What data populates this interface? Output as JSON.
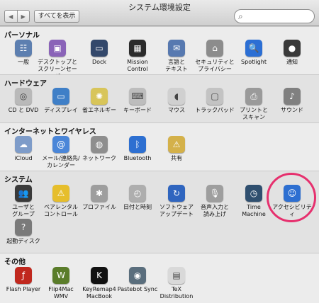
{
  "window": {
    "title": "システム環境設定",
    "show_all": "すべてを表示",
    "back": "◀",
    "forward": "▶",
    "search_placeholder": ""
  },
  "sections": [
    {
      "title": "パーソナル",
      "items": [
        {
          "label": "一般",
          "icon": "general-icon",
          "glyph": "☷",
          "color": "#5d7fb0"
        },
        {
          "label": "デスクトップと\nスクリーンセーバ",
          "icon": "desktop-screensaver-icon",
          "glyph": "▣",
          "color": "#8a63b8"
        },
        {
          "label": "Dock",
          "icon": "dock-icon",
          "glyph": "▭",
          "color": "#33486b"
        },
        {
          "label": "Mission\nControl",
          "icon": "mission-control-icon",
          "glyph": "▦",
          "color": "#2b2b2b"
        },
        {
          "label": "言語と\nテキスト",
          "icon": "language-text-icon",
          "glyph": "✉",
          "color": "#5779b0"
        },
        {
          "label": "セキュリティと\nプライバシー",
          "icon": "security-privacy-icon",
          "glyph": "⌂",
          "color": "#8c8c8c"
        },
        {
          "label": "Spotlight",
          "icon": "spotlight-icon",
          "glyph": "🔍",
          "color": "#2c6fd4"
        },
        {
          "label": "通知",
          "icon": "notifications-icon",
          "glyph": "●",
          "color": "#3a3a3a"
        }
      ]
    },
    {
      "title": "ハードウェア",
      "items": [
        {
          "label": "CD と DVD",
          "icon": "cd-dvd-icon",
          "glyph": "◎",
          "color": "#b9b9b9"
        },
        {
          "label": "ディスプレイ",
          "icon": "display-icon",
          "glyph": "▭",
          "color": "#3f7fc7"
        },
        {
          "label": "省エネルギー",
          "icon": "energy-saver-icon",
          "glyph": "✺",
          "color": "#d8c55a"
        },
        {
          "label": "キーボード",
          "icon": "keyboard-icon",
          "glyph": "⌨",
          "color": "#bdbdbd"
        },
        {
          "label": "マウス",
          "icon": "mouse-icon",
          "glyph": "◖",
          "color": "#d0d0d0"
        },
        {
          "label": "トラックパッド",
          "icon": "trackpad-icon",
          "glyph": "▢",
          "color": "#c3c3c3"
        },
        {
          "label": "プリントと\nスキャン",
          "icon": "print-scan-icon",
          "glyph": "⎙",
          "color": "#9a9a9a"
        },
        {
          "label": "サウンド",
          "icon": "sound-icon",
          "glyph": "♪",
          "color": "#808080"
        }
      ]
    },
    {
      "title": "インターネットとワイヤレス",
      "items": [
        {
          "label": "iCloud",
          "icon": "icloud-icon",
          "glyph": "☁",
          "color": "#7e9cc9"
        },
        {
          "label": "メール/連絡先/\nカレンダー",
          "icon": "mail-contacts-calendar-icon",
          "glyph": "@",
          "color": "#4a86d8"
        },
        {
          "label": "ネットワーク",
          "icon": "network-icon",
          "glyph": "◍",
          "color": "#8e8e8e"
        },
        {
          "label": "Bluetooth",
          "icon": "bluetooth-icon",
          "glyph": "ᛒ",
          "color": "#2d6fd1"
        },
        {
          "label": "共有",
          "icon": "sharing-icon",
          "glyph": "⚠",
          "color": "#d4b14a"
        }
      ]
    },
    {
      "title": "システム",
      "items": [
        {
          "label": "ユーザと\nグループ",
          "icon": "users-groups-icon",
          "glyph": "👥",
          "color": "#3a3a3a"
        },
        {
          "label": "ペアレンタル\nコントロール",
          "icon": "parental-controls-icon",
          "glyph": "⚠",
          "color": "#e6be2c"
        },
        {
          "label": "プロファイル",
          "icon": "profiles-icon",
          "glyph": "✱",
          "color": "#9e9e9e"
        },
        {
          "label": "日付と時刻",
          "icon": "date-time-icon",
          "glyph": "◴",
          "color": "#aeaeae"
        },
        {
          "label": "ソフトウェア\nアップデート",
          "icon": "software-update-icon",
          "glyph": "↻",
          "color": "#2f65bf"
        },
        {
          "label": "音声入力と\n読み上げ",
          "icon": "dictation-speech-icon",
          "glyph": "🎙",
          "color": "#9e9e9e"
        },
        {
          "label": "Time\nMachine",
          "icon": "time-machine-icon",
          "glyph": "◷",
          "color": "#2f4f6f"
        },
        {
          "label": "アクセシビリティ",
          "icon": "accessibility-icon",
          "glyph": "☺",
          "color": "#2d6fd1"
        },
        {
          "label": "起動ディスク",
          "icon": "startup-disk-icon",
          "glyph": "?",
          "color": "#7a7a7a"
        }
      ]
    },
    {
      "title": "その他",
      "items": [
        {
          "label": "Flash Player",
          "icon": "flash-player-icon",
          "glyph": "ƒ",
          "color": "#c0281e"
        },
        {
          "label": "Flip4Mac\nWMV",
          "icon": "flip4mac-icon",
          "glyph": "W",
          "color": "#5a7c2a"
        },
        {
          "label": "KeyRemap4\nMacBook",
          "icon": "keyremap4macbook-icon",
          "glyph": "K",
          "color": "#111111"
        },
        {
          "label": "Pastebot Sync",
          "icon": "pastebot-sync-icon",
          "glyph": "◉",
          "color": "#5a6e7d"
        },
        {
          "label": "TeX\nDistribution",
          "icon": "tex-distribution-icon",
          "glyph": "▤",
          "color": "#d9d9d9"
        }
      ]
    }
  ]
}
